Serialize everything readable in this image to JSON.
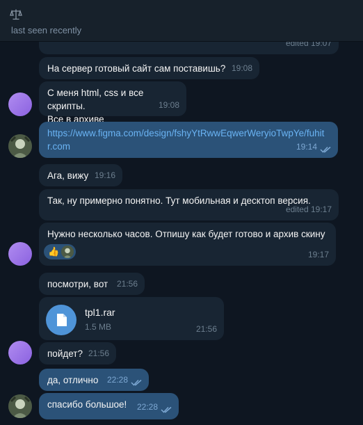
{
  "header": {
    "status": "last seen recently",
    "icon": "scale-icon"
  },
  "messages": [
    {
      "id": "m0",
      "text": "",
      "time": "edited 19:07",
      "direction": "in"
    },
    {
      "id": "m1",
      "text": "На сервер готовый сайт сам поставишь?",
      "time": "19:08",
      "direction": "in"
    },
    {
      "id": "m2",
      "line1": "С меня html, css и все скрипты.",
      "line2": "Все в архиве",
      "time": "19:08",
      "direction": "in"
    },
    {
      "id": "m3",
      "line1": "https://www.figma.com/design/fshyYtRwwEqwerWeryioTwpYe/fuhit",
      "line2": "r.com",
      "time": "19:14",
      "direction": "out",
      "read": true
    },
    {
      "id": "m4",
      "text": "Ага, вижу",
      "time": "19:16",
      "direction": "in"
    },
    {
      "id": "m5",
      "text": "Так, ну примерно понятно. Тут мобильная и десктоп версия.",
      "time": "edited 19:17",
      "direction": "in"
    },
    {
      "id": "m6",
      "text": "Нужно несколько часов. Отпишу как будет готово и архив скину",
      "time": "19:17",
      "direction": "in",
      "reaction": "👍"
    },
    {
      "id": "m7",
      "text": "посмотри, вот",
      "time": "21:56",
      "direction": "in"
    },
    {
      "id": "m8",
      "file_name": "tpl1.rar",
      "file_size": "1.5 MB",
      "time": "21:56",
      "direction": "in"
    },
    {
      "id": "m9",
      "text": "пойдет?",
      "time": "21:56",
      "direction": "in"
    },
    {
      "id": "m10",
      "text": "да, отлично",
      "time": "22:28",
      "direction": "out",
      "read": true
    },
    {
      "id": "m11",
      "text": "спасибо большое!",
      "time": "22:28",
      "direction": "out",
      "read": true
    }
  ],
  "colors": {
    "background": "#0e1621",
    "bubble_in": "#182533",
    "bubble_out": "#2b5278",
    "link": "#6ab3f3",
    "avatar_purple": "#9a74e8"
  }
}
